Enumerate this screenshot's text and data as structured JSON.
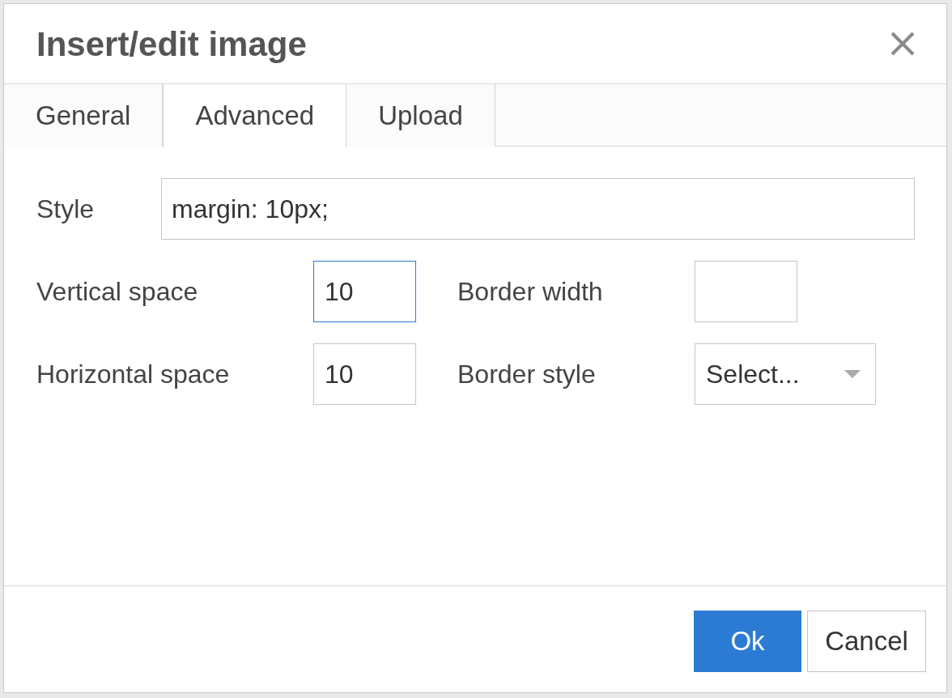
{
  "window": {
    "title": "Insert/edit image"
  },
  "tabs": [
    {
      "label": "General",
      "selected": false
    },
    {
      "label": "Advanced",
      "selected": true
    },
    {
      "label": "Upload",
      "selected": false
    }
  ],
  "style_field": {
    "label": "Style",
    "value": "margin: 10px;"
  },
  "fields": [
    {
      "kind": "text",
      "label": "Vertical space",
      "value": "10",
      "focused": true
    },
    {
      "kind": "text",
      "label": "Border width",
      "focused": false
    },
    {
      "kind": "text",
      "label": "Horizontal space",
      "value": "10",
      "focused": false
    },
    {
      "kind": "select",
      "label": "Border style",
      "value": "Select...",
      "focused": false
    }
  ],
  "buttons": [
    {
      "label": "Ok",
      "primary": true
    },
    {
      "label": "Cancel",
      "primary": false
    }
  ]
}
